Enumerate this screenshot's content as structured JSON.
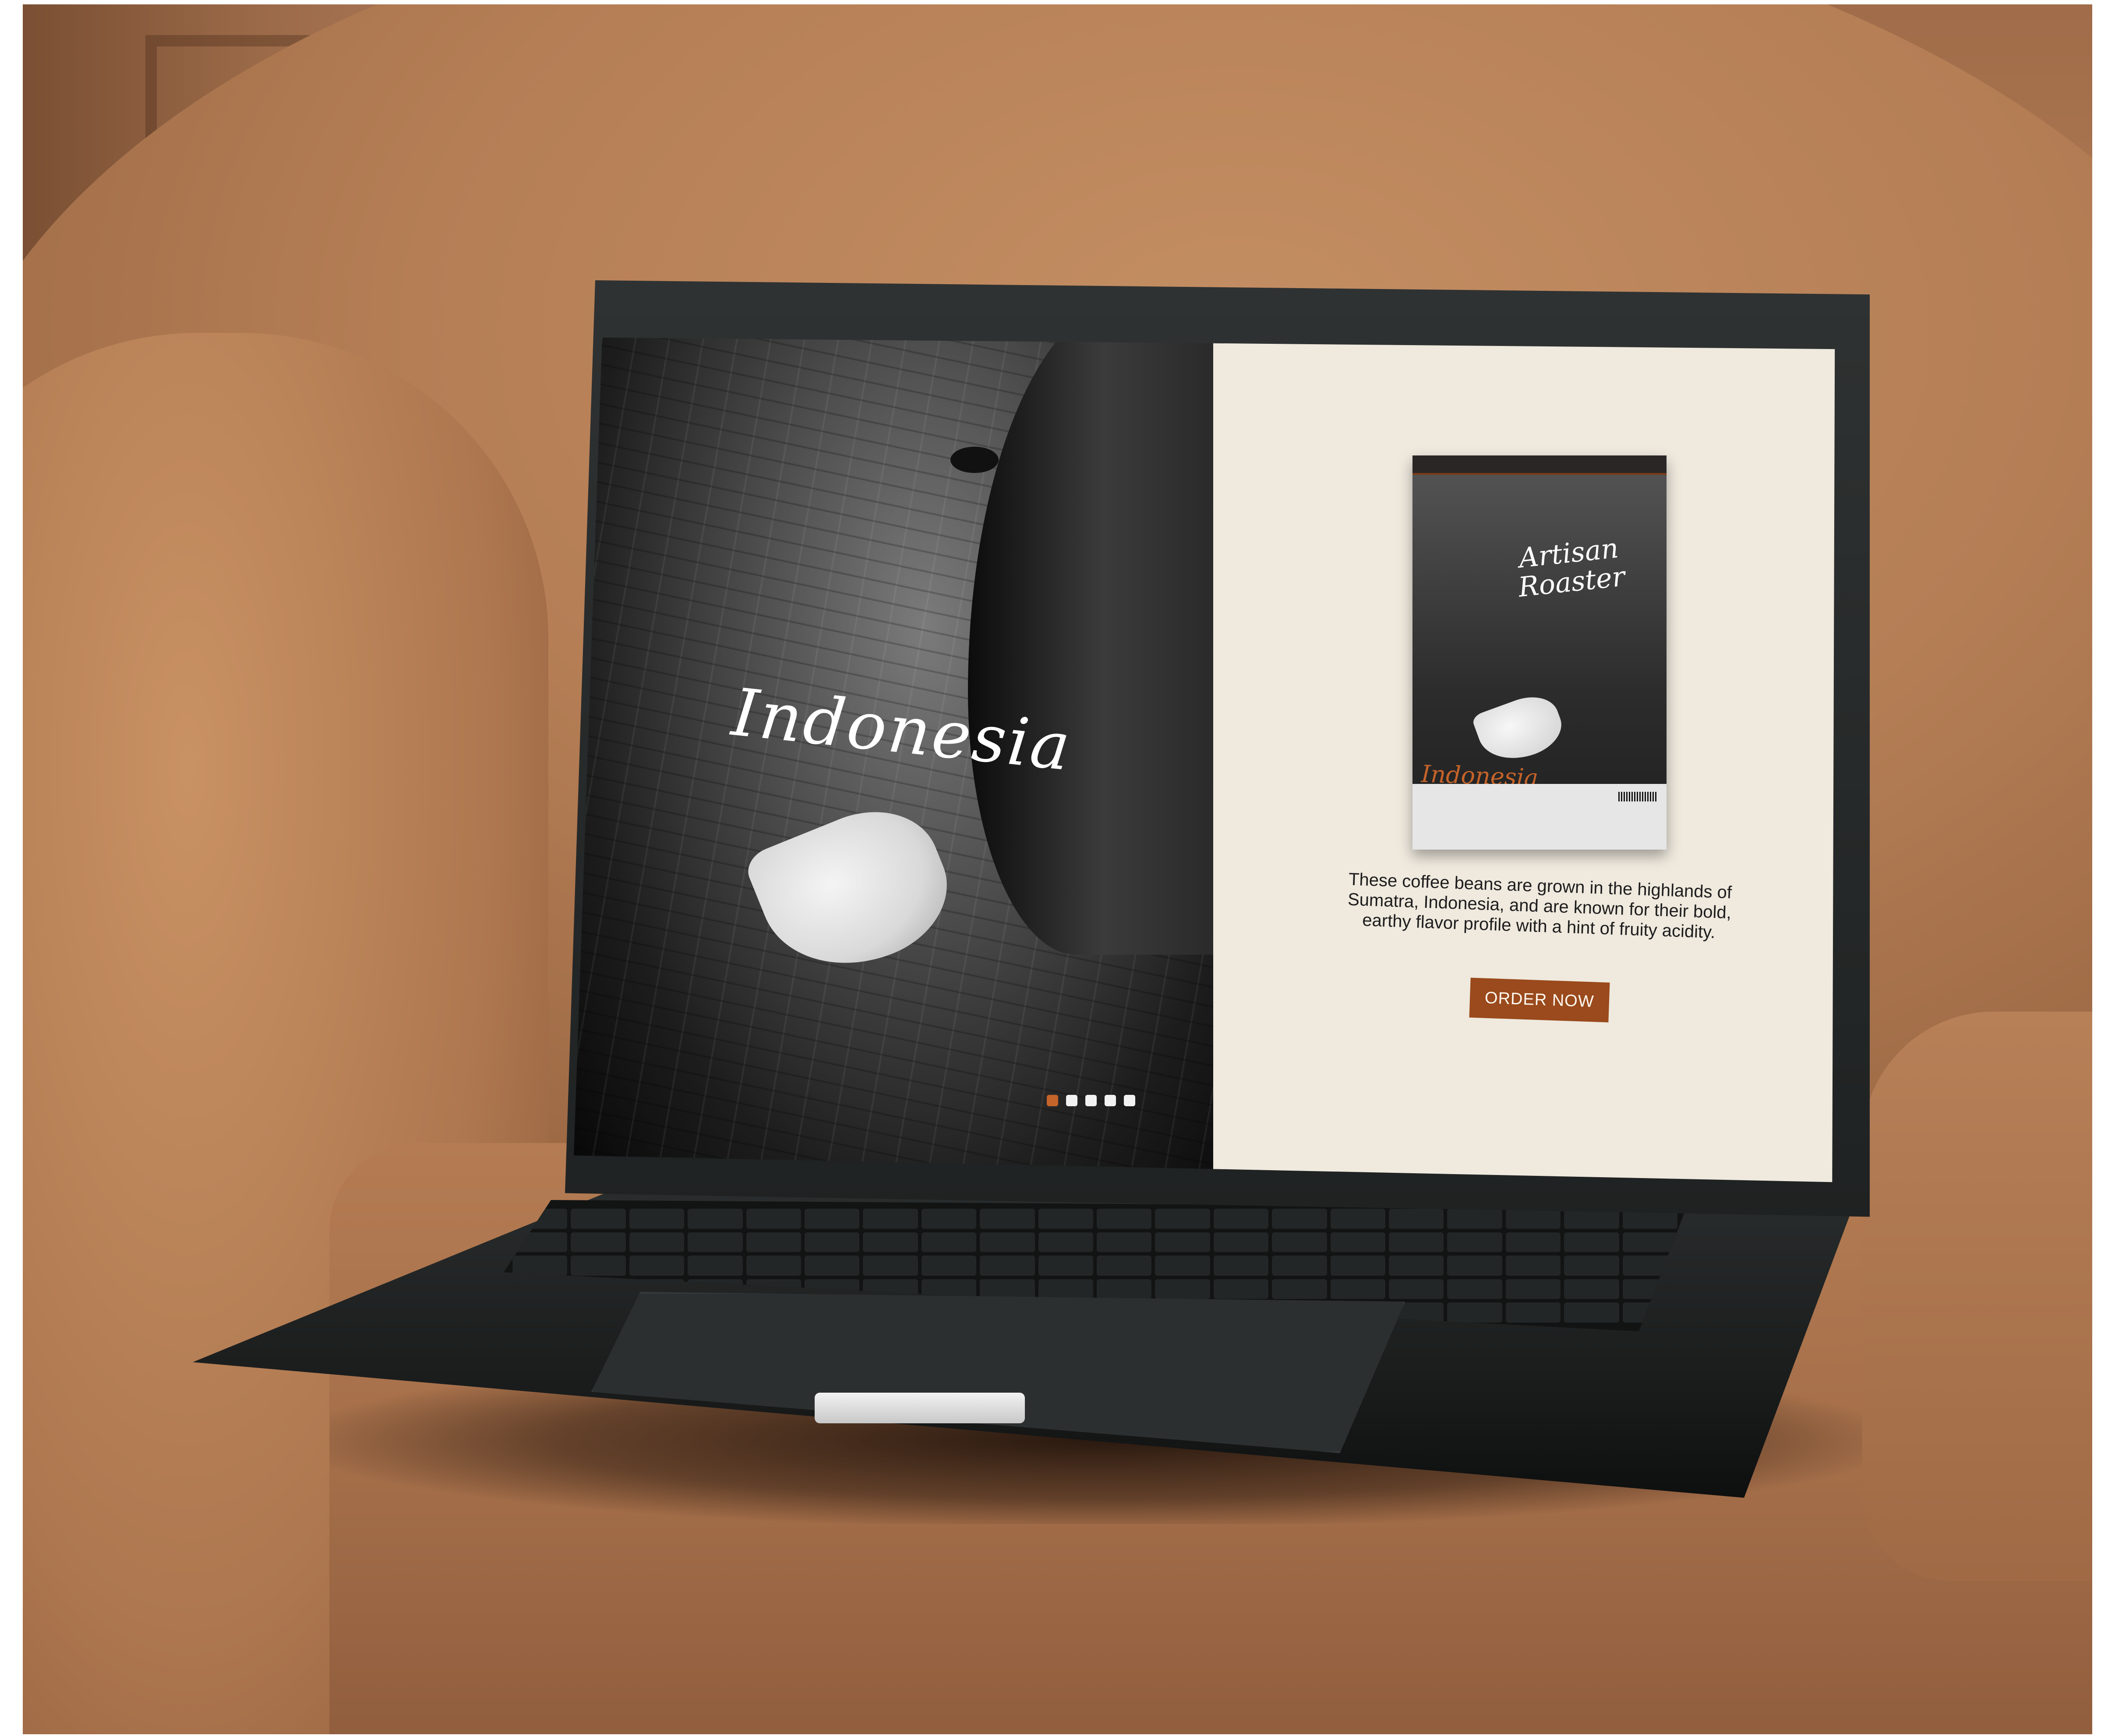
{
  "hero": {
    "title": "Indonesia",
    "slides_total": 5,
    "active_slide": 1
  },
  "product": {
    "brand_line_1": "Artisan",
    "brand_line_2": "Roaster",
    "bag_origin": "Indonesia",
    "description": "These coffee beans are grown in the highlands of Sumatra, Indonesia, and are known for their bold, earthy flavor profile with a hint of fruity acidity.",
    "cta_label": "ORDER NOW"
  },
  "colors": {
    "accent": "#c4632a",
    "cta_background": "#9a4a1c",
    "panel_background": "#efe9de",
    "sofa": "#b57e55"
  }
}
